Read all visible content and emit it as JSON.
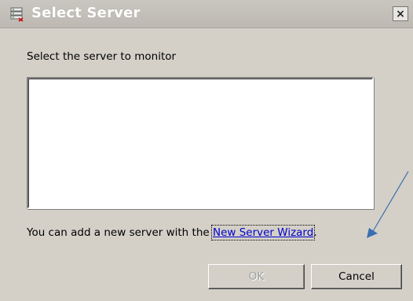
{
  "window": {
    "title": "Select Server",
    "close_glyph": "×"
  },
  "main": {
    "prompt": "Select the server to monitor",
    "server_list": {
      "items": []
    },
    "footer_prefix": "You can add a new server with the ",
    "footer_link": "New Server Wizard",
    "footer_suffix": "."
  },
  "buttons": {
    "ok_label": "OK",
    "ok_enabled": false,
    "cancel_label": "Cancel"
  },
  "annotation": {
    "arrow_color": "#3a6fb0"
  }
}
